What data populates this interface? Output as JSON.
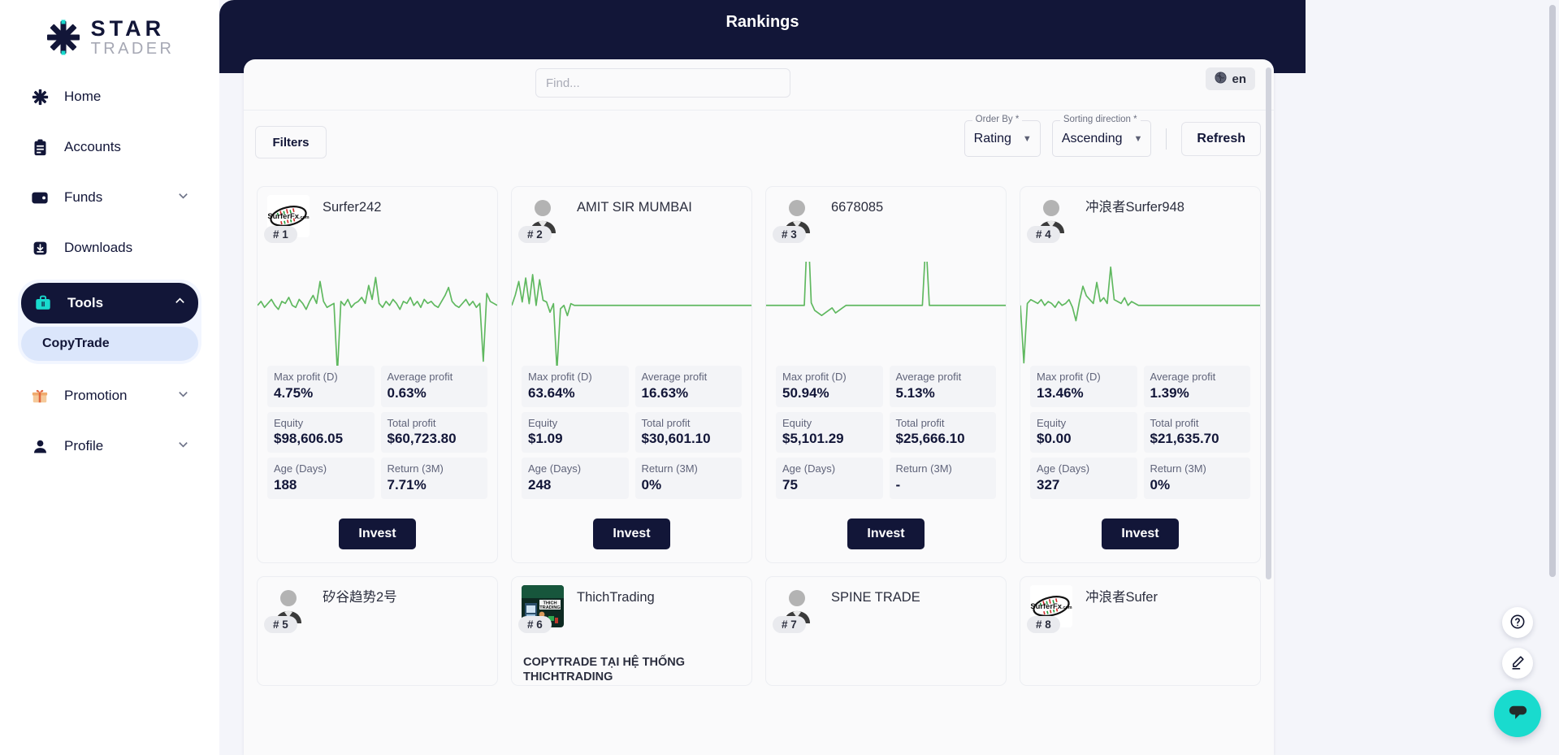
{
  "brand": {
    "name_top": "STAR",
    "name_bottom": "TRADER",
    "logo_icon": "star-burst-icon",
    "accent": "#19dbce",
    "navy": "#121638"
  },
  "sidebar": {
    "items": [
      {
        "label": "Home",
        "icon": "star-burst-icon",
        "expandable": false,
        "active": false
      },
      {
        "label": "Accounts",
        "icon": "clipboard-icon",
        "expandable": false,
        "active": false
      },
      {
        "label": "Funds",
        "icon": "wallet-icon",
        "expandable": true,
        "active": false
      },
      {
        "label": "Downloads",
        "icon": "download-icon",
        "expandable": false,
        "active": false
      }
    ],
    "active_group": {
      "label": "Tools",
      "icon": "briefcase-icon",
      "chevron": "chevron-up-icon",
      "sub_items": [
        {
          "label": "CopyTrade",
          "active": true
        }
      ]
    },
    "bottom_items": [
      {
        "label": "Promotion",
        "icon": "gift-box-icon",
        "expandable": true
      },
      {
        "label": "Profile",
        "icon": "person-icon",
        "expandable": true
      }
    ]
  },
  "header": {
    "title": "Rankings"
  },
  "search": {
    "placeholder": "Find...",
    "value": ""
  },
  "language": {
    "code": "en",
    "icon": "globe-icon"
  },
  "controls": {
    "filters_label": "Filters",
    "order_by": {
      "legend": "Order By *",
      "value": "Rating",
      "icon": "chevron-down-icon"
    },
    "sorting_direction": {
      "legend": "Sorting direction *",
      "value": "Ascending",
      "icon": "chevron-down-icon"
    },
    "refresh_label": "Refresh"
  },
  "stat_labels": {
    "max_profit": "Max profit (D)",
    "average_profit": "Average profit",
    "equity": "Equity",
    "total_profit": "Total profit",
    "age": "Age (Days)",
    "return_3m": "Return (3M)"
  },
  "invest_label": "Invest",
  "cards": [
    {
      "rank": "# 1",
      "name": "Surfer242",
      "avatar": "surferfx-logo",
      "description": "",
      "max_profit": "4.75%",
      "average_profit": "0.63%",
      "equity": "$98,606.05",
      "total_profit": "$60,723.80",
      "age": "188",
      "return_3m": "7.71%"
    },
    {
      "rank": "# 2",
      "name": "AMIT SIR MUMBAI",
      "avatar": "person-placeholder",
      "description": "",
      "max_profit": "63.64%",
      "average_profit": "16.63%",
      "equity": "$1.09",
      "total_profit": "$30,601.10",
      "age": "248",
      "return_3m": "0%"
    },
    {
      "rank": "# 3",
      "name": "6678085",
      "avatar": "person-placeholder",
      "description": "",
      "max_profit": "50.94%",
      "average_profit": "5.13%",
      "equity": "$5,101.29",
      "total_profit": "$25,666.10",
      "age": "75",
      "return_3m": "-"
    },
    {
      "rank": "# 4",
      "name": "冲浪者Surfer948",
      "avatar": "person-placeholder",
      "description": "",
      "max_profit": "13.46%",
      "average_profit": "1.39%",
      "equity": "$0.00",
      "total_profit": "$21,635.70",
      "age": "327",
      "return_3m": "0%"
    },
    {
      "rank": "# 5",
      "name": "矽谷趋势2号",
      "avatar": "person-placeholder",
      "description": "",
      "max_profit": "",
      "average_profit": "",
      "equity": "",
      "total_profit": "",
      "age": "",
      "return_3m": ""
    },
    {
      "rank": "# 6",
      "name": "ThichTrading",
      "avatar": "thichtrading-logo",
      "description": "COPYTRADE TẠI HỆ THỐNG THICHTRADING",
      "max_profit": "",
      "average_profit": "",
      "equity": "",
      "total_profit": "",
      "age": "",
      "return_3m": ""
    },
    {
      "rank": "# 7",
      "name": "SPINE TRADE",
      "avatar": "person-placeholder",
      "description": "",
      "max_profit": "",
      "average_profit": "",
      "equity": "",
      "total_profit": "",
      "age": "",
      "return_3m": ""
    },
    {
      "rank": "# 8",
      "name": "冲浪者Sufer",
      "avatar": "surferfx-logo",
      "description": "",
      "max_profit": "",
      "average_profit": "",
      "equity": "",
      "total_profit": "",
      "age": "",
      "return_3m": ""
    }
  ],
  "chart_data": [
    {
      "type": "line",
      "title": "Surfer242 equity sparkline",
      "color": "#5fb85f",
      "ylabel": "",
      "xlabel": "",
      "legend": "none",
      "grid": false,
      "y": [
        0,
        2,
        -1,
        1,
        3,
        0,
        -2,
        2,
        1,
        4,
        0,
        -1,
        3,
        1,
        -2,
        2,
        5,
        1,
        12,
        2,
        -1,
        0,
        1,
        -34,
        2,
        0,
        3,
        -1,
        1,
        2,
        4,
        1,
        10,
        3,
        14,
        1,
        -1,
        2,
        0,
        3,
        1,
        -2,
        2,
        1,
        4,
        0,
        2,
        -1,
        3,
        1,
        2,
        0,
        -1,
        2,
        5,
        9,
        2,
        0,
        -1,
        1,
        3,
        0,
        2,
        -1,
        1,
        -28,
        6,
        2,
        1,
        0
      ]
    },
    {
      "type": "line",
      "title": "AMIT SIR MUMBAI equity sparkline",
      "color": "#5fb85f",
      "ylabel": "",
      "xlabel": "",
      "legend": "none",
      "grid": false,
      "y": [
        0,
        6,
        14,
        2,
        16,
        1,
        18,
        0,
        15,
        3,
        2,
        -4,
        1,
        -38,
        -2,
        0,
        -6,
        1,
        0,
        0,
        0,
        0,
        0,
        0,
        0,
        0,
        0,
        0,
        0,
        0,
        0,
        0,
        0,
        0,
        0,
        0,
        0,
        0,
        0,
        0,
        0,
        0,
        0,
        0,
        0,
        0,
        0,
        0,
        0,
        0,
        0,
        0,
        0,
        0,
        0,
        0,
        0,
        0,
        0,
        0,
        0,
        0,
        0,
        0,
        0,
        0,
        0,
        0,
        0,
        0
      ]
    },
    {
      "type": "line",
      "title": "6678085 equity sparkline",
      "color": "#5fb85f",
      "ylabel": "",
      "xlabel": "",
      "legend": "none",
      "grid": false,
      "y": [
        0,
        0,
        0,
        0,
        0,
        0,
        0,
        0,
        0,
        0,
        0,
        0,
        34,
        1,
        -2,
        -3,
        -4,
        -3,
        -2,
        -1,
        -3,
        -2,
        -1,
        0,
        0,
        0,
        0,
        0,
        0,
        0,
        0,
        0,
        0,
        0,
        0,
        0,
        0,
        0,
        0,
        0,
        0,
        0,
        0,
        0,
        0,
        0,
        26,
        0,
        0,
        0,
        0,
        0,
        0,
        0,
        0,
        0,
        0,
        0,
        0,
        0,
        0,
        0,
        0,
        0,
        0,
        0,
        0,
        0,
        0,
        0
      ]
    },
    {
      "type": "line",
      "title": "冲浪者Surfer948 equity sparkline",
      "color": "#5fb85f",
      "ylabel": "",
      "xlabel": "",
      "legend": "none",
      "grid": false,
      "y": [
        0,
        -30,
        1,
        3,
        2,
        1,
        3,
        0,
        2,
        1,
        -1,
        2,
        0,
        1,
        3,
        -1,
        -8,
        2,
        10,
        5,
        3,
        1,
        12,
        2,
        4,
        1,
        20,
        3,
        2,
        1,
        4,
        0,
        2,
        1,
        0,
        0,
        0,
        0,
        0,
        0,
        0,
        0,
        0,
        0,
        0,
        0,
        0,
        0,
        0,
        0,
        0,
        0,
        0,
        0,
        0,
        0,
        0,
        0,
        0,
        0,
        0,
        0,
        0,
        0,
        0,
        0,
        0,
        0,
        0,
        0
      ]
    }
  ],
  "fabs": [
    {
      "icon": "help-circle-icon",
      "style": "white"
    },
    {
      "icon": "pencil-edit-icon",
      "style": "white"
    },
    {
      "icon": "chat-bubble-icon",
      "style": "teal"
    }
  ]
}
